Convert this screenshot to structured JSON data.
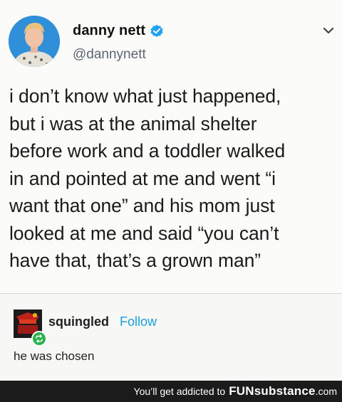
{
  "tweet": {
    "display_name": "danny nett",
    "handle": "@dannynett",
    "text": "i don’t know what just happened,\nbut i was at the animal shelter\nbefore work and a toddler walked\nin and pointed at me and went “i\nwant that one” and his mom just\nlooked at me and said “you can’t\nhave that, that’s a grown man”",
    "icons": {
      "verified": "verified-badge-icon",
      "menu": "chevron-down-icon"
    },
    "colors": {
      "verified": "#1da1f2"
    }
  },
  "reblog": {
    "username": "squingled",
    "follow_label": "Follow",
    "text": "he was chosen",
    "icons": {
      "reblog": "reblog-icon"
    },
    "colors": {
      "follow": "#1ba1d8",
      "reblog_badge": "#2bb24c"
    }
  },
  "footer": {
    "tagline": "You’ll get addicted to",
    "brand": "FUNsubstance",
    "domain": ".com"
  }
}
